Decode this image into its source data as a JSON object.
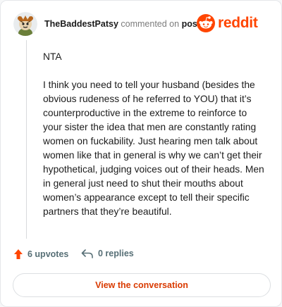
{
  "header": {
    "username": "TheBaddestPatsy",
    "action_text": "commented on",
    "post_label": "post",
    "logo_text": "reddit",
    "brand_color": "#ff4500"
  },
  "comment": {
    "paragraphs": [
      "NTA",
      "I think you need to tell your husband (besides the obvious rudeness of he referred to YOU) that it’s counterproductive in the extreme to reinforce to your sister the idea that men are constantly rating women on fuckability. Just hearing men talk about women like that in general is why we can’t get their hypothetical, judging voices out of their heads. Men in general just need to shut their mouths about women’s appearance except to tell their specific partners that they’re beautiful."
    ]
  },
  "stats": {
    "upvotes": "6 upvotes",
    "replies": "0 replies",
    "upvote_icon": "upvote-arrow-icon",
    "reply_icon": "reply-arrow-icon"
  },
  "actions": {
    "view_label": "View the conversation"
  }
}
